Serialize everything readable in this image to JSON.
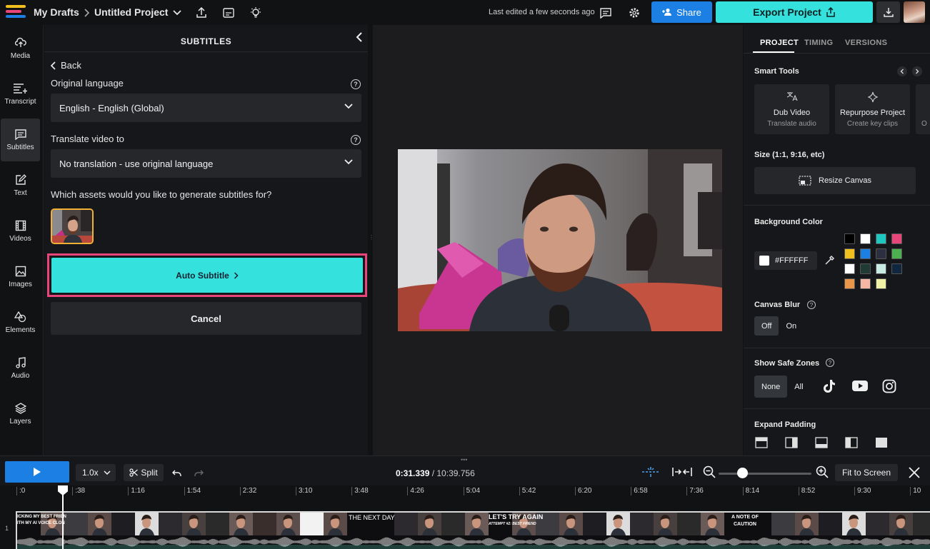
{
  "topbar": {
    "breadcrumb_root": "My Drafts",
    "project_name": "Untitled Project",
    "last_edited": "Last edited a few seconds ago",
    "share_label": "Share",
    "export_label": "Export Project"
  },
  "leftnav": {
    "items": [
      {
        "label": "Media",
        "icon": "upload-cloud-icon"
      },
      {
        "label": "Transcript",
        "icon": "transcript-icon"
      },
      {
        "label": "Subtitles",
        "icon": "subtitles-icon",
        "active": true
      },
      {
        "label": "Text",
        "icon": "text-edit-icon"
      },
      {
        "label": "Videos",
        "icon": "film-icon"
      },
      {
        "label": "Images",
        "icon": "image-icon"
      },
      {
        "label": "Elements",
        "icon": "shapes-icon"
      },
      {
        "label": "Audio",
        "icon": "music-note-icon"
      },
      {
        "label": "Layers",
        "icon": "layers-icon"
      }
    ]
  },
  "subtitles_panel": {
    "title": "SUBTITLES",
    "back_label": "Back",
    "original_language_label": "Original language",
    "original_language_value": "English - English (Global)",
    "translate_label": "Translate video to",
    "translate_value": "No translation - use original language",
    "assets_question": "Which assets would you like to generate subtitles for?",
    "auto_subtitle_label": "Auto Subtitle",
    "cancel_label": "Cancel"
  },
  "right_panel": {
    "tabs": [
      "PROJECT",
      "TIMING",
      "VERSIONS"
    ],
    "active_tab": "PROJECT",
    "smart_tools_title": "Smart Tools",
    "tools": [
      {
        "title": "Dub Video",
        "subtitle": "Translate audio"
      },
      {
        "title": "Repurpose Project",
        "subtitle": "Create key clips"
      },
      {
        "title": "",
        "subtitle": "O"
      }
    ],
    "size_title": "Size (1:1, 9:16, etc)",
    "resize_label": "Resize Canvas",
    "background_title": "Background Color",
    "background_value": "#FFFFFF",
    "swatches": [
      "#000000",
      "#ffffff",
      "#1fc7c1",
      "#e8457a",
      "#f2c01e",
      "#1b7fe3",
      "#2c2f3f",
      "#4caf50",
      "#ffffff",
      "#1f3b34",
      "#c8ece2",
      "#0f2840",
      "#e8964a",
      "#f4b8a4",
      "#f1f0a8"
    ],
    "canvas_blur_title": "Canvas Blur",
    "blur_options": [
      "Off",
      "On"
    ],
    "blur_selected": "Off",
    "safe_zones_title": "Show Safe Zones",
    "safe_zone_options": [
      "None",
      "All"
    ],
    "safe_zone_selected": "None",
    "expand_padding_title": "Expand Padding"
  },
  "timeline": {
    "speed": "1.0x",
    "split_label": "Split",
    "current_time": "0:31.339",
    "total_time": "/ 10:39.756",
    "fit_label": "Fit to Screen",
    "track_number": "1",
    "ruler_labels": [
      ":0",
      ":38",
      "1:16",
      "1:54",
      "2:32",
      "3:10",
      "3:48",
      "4:26",
      "5:04",
      "5:42",
      "6:20",
      "6:58",
      "7:36",
      "8:14",
      "8:52",
      "9:30",
      "10"
    ],
    "clip_texts": {
      "first_line1": "ICKING MY BEST FRIEN",
      "first_line2": "ITH MY AI VOICE CLON",
      "next_day": "THE NEXT DAY",
      "lets_try": "LET'S TRY AGAIN",
      "lets_try_sub": "ATTEMPT #2: BEST FRIEND",
      "note1": "A NOTE OF",
      "note2": "CAUTION"
    }
  }
}
